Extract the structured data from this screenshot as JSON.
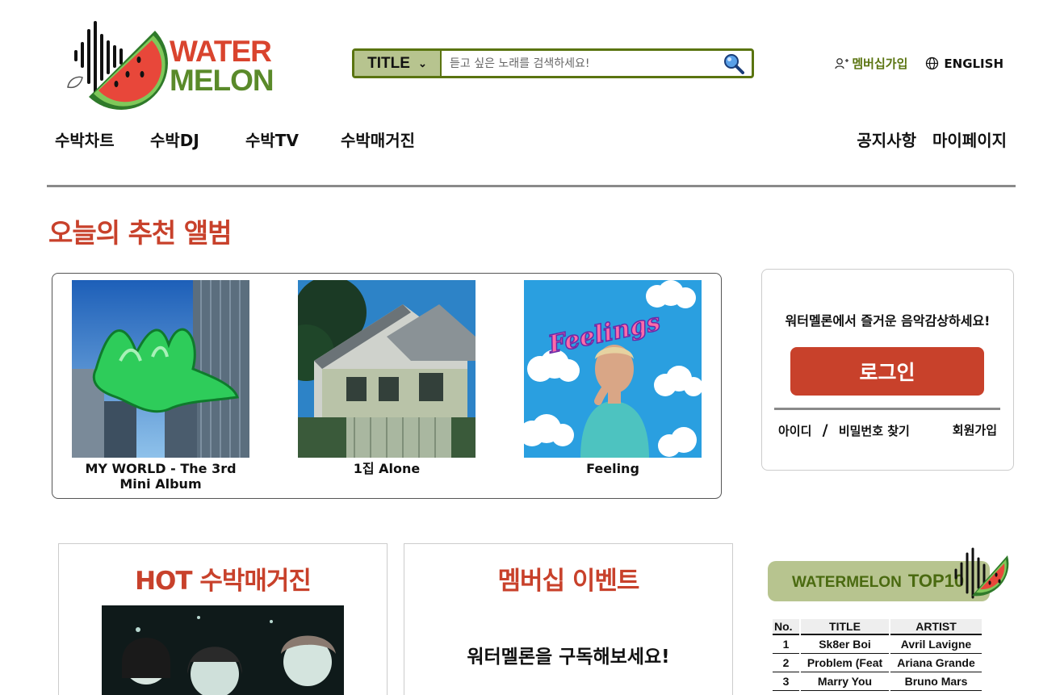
{
  "brand": {
    "line1": "WATER",
    "line2": "MELON"
  },
  "search": {
    "type_label": "TITLE",
    "placeholder": "듣고 싶은 노래를 검색하세요!"
  },
  "top_links": {
    "membership": "멤버십가입",
    "language": "ENGLISH"
  },
  "nav": {
    "left": [
      "수박차트",
      "수박DJ",
      "수박TV",
      "수박매거진"
    ],
    "right": [
      "공지사항",
      "마이페이지"
    ]
  },
  "recommend": {
    "title": "오늘의 추천 앨범",
    "albums": [
      {
        "title": "MY WORLD - The 3rd Mini Album"
      },
      {
        "title": "1집 Alone"
      },
      {
        "title": "Feeling"
      }
    ]
  },
  "login_box": {
    "message": "워터멜론에서 즐거운 음악감상하세요!",
    "login_button": "로그인",
    "find_id": "아이디",
    "separator": "/",
    "find_password": "비밀번호 찾기",
    "signup": "회원가입"
  },
  "magazine": {
    "title": "HOT 수박매거진"
  },
  "membership_event": {
    "title": "멤버십 이벤트",
    "subtitle": "워터멜론을 구독해보세요!"
  },
  "top10": {
    "label_a": "WATERMELON",
    "label_b": "TOP10",
    "headers": {
      "no": "No.",
      "title": "TITLE",
      "artist": "ARTIST"
    },
    "rows": [
      {
        "no": "1",
        "title": "Sk8er Boi",
        "artist": "Avril Lavigne"
      },
      {
        "no": "2",
        "title": "Problem (Feat",
        "artist": "Ariana Grande"
      },
      {
        "no": "3",
        "title": "Marry You",
        "artist": "Bruno Mars"
      }
    ]
  },
  "colors": {
    "brand_red": "#c8412b",
    "brand_green": "#5a7410",
    "sage": "#b7c48f"
  }
}
